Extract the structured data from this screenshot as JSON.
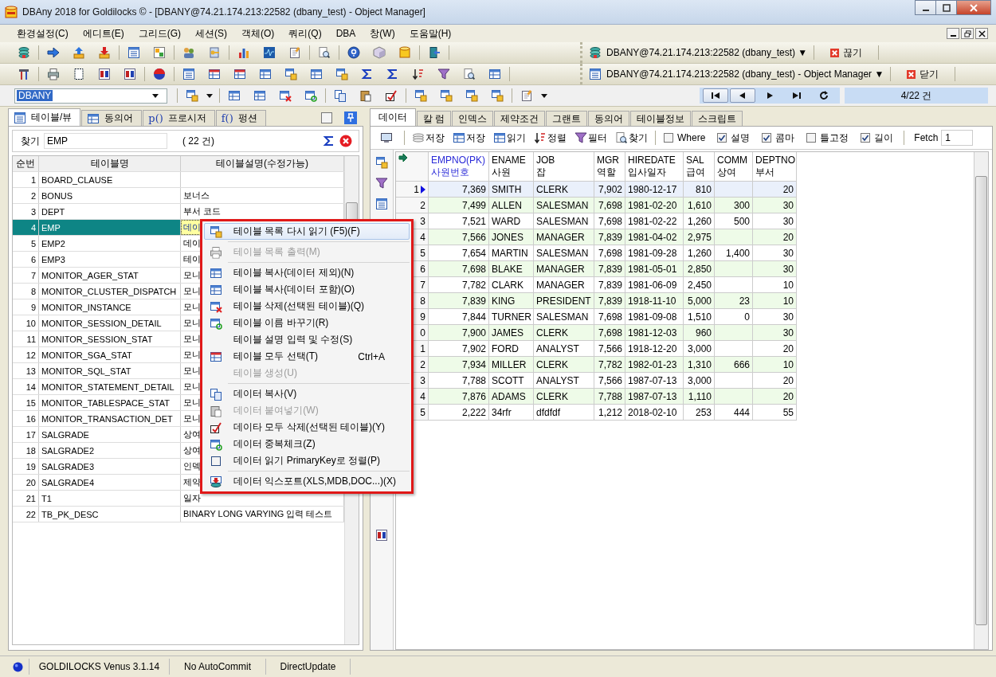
{
  "window": {
    "title": "DBAny 2018 for Goldilocks © - [DBANY@74.21.174.213:22582 (dbany_test) - Object Manager]"
  },
  "menu_bar": [
    "환경설정(C)",
    "에디트(E)",
    "그리드(G)",
    "세션(S)",
    "객체(O)",
    "쿼리(Q)",
    "DBA",
    "창(W)",
    "도움말(H)"
  ],
  "connection_bar": {
    "label": "DBANY@74.21.174.213:22582 (dbany_test) ▼",
    "action": "끊기"
  },
  "window_bar": {
    "label": "DBANY@74.21.174.213:22582 (dbany_test) - Object Manager ▼",
    "action": "닫기"
  },
  "schema_combo": {
    "value": "DBANY"
  },
  "record_counter": "4/22 건",
  "left_panel": {
    "tabs": [
      {
        "label": "테이블/뷰",
        "selected": true
      },
      {
        "label": "동의어",
        "selected": false
      },
      {
        "label": "프로시저",
        "icon_text": "p()",
        "selected": false
      },
      {
        "label": "펑션",
        "icon_text": "f()",
        "selected": false
      }
    ],
    "search": {
      "label": "찾기",
      "value": "EMP",
      "count": "( 22 건)"
    },
    "columns": [
      "순번",
      "테이블명",
      "테이블설명(수정가능)"
    ],
    "rows": [
      {
        "no": "1",
        "name": "BOARD_CLAUSE",
        "selected": false
      },
      {
        "no": "2",
        "name": "BONUS",
        "description": "보너스",
        "selected": false
      },
      {
        "no": "3",
        "name": "DEPT",
        "description": "부서 코드",
        "selected": false
      },
      {
        "no": "4",
        "name": "EMP",
        "description": "데이",
        "selected": true
      },
      {
        "no": "5",
        "name": "EMP2",
        "description": "데이",
        "selected": false
      },
      {
        "no": "6",
        "name": "EMP3",
        "description": "테이",
        "selected": false
      },
      {
        "no": "7",
        "name": "MONITOR_AGER_STAT",
        "description": "모니",
        "selected": false
      },
      {
        "no": "8",
        "name": "MONITOR_CLUSTER_DISPATCH",
        "description": "모니",
        "selected": false
      },
      {
        "no": "9",
        "name": "MONITOR_INSTANCE",
        "description": "모니",
        "selected": false
      },
      {
        "no": "10",
        "name": "MONITOR_SESSION_DETAIL",
        "description": "모니",
        "selected": false
      },
      {
        "no": "11",
        "name": "MONITOR_SESSION_STAT",
        "description": "모니",
        "selected": false
      },
      {
        "no": "12",
        "name": "MONITOR_SGA_STAT",
        "description": "모니",
        "selected": false
      },
      {
        "no": "13",
        "name": "MONITOR_SQL_STAT",
        "description": "모니",
        "selected": false
      },
      {
        "no": "14",
        "name": "MONITOR_STATEMENT_DETAIL",
        "description": "모니",
        "selected": false
      },
      {
        "no": "15",
        "name": "MONITOR_TABLESPACE_STAT",
        "description": "모니",
        "selected": false
      },
      {
        "no": "16",
        "name": "MONITOR_TRANSACTION_DET",
        "description": "모니",
        "selected": false
      },
      {
        "no": "17",
        "name": "SALGRADE",
        "description": "상여",
        "selected": false
      },
      {
        "no": "18",
        "name": "SALGRADE2",
        "description": "상여",
        "selected": false
      },
      {
        "no": "19",
        "name": "SALGRADE3",
        "description": "인덱",
        "selected": false
      },
      {
        "no": "20",
        "name": "SALGRADE4",
        "description": "제약",
        "selected": false
      },
      {
        "no": "21",
        "name": "T1",
        "description": "일자",
        "selected": false
      },
      {
        "no": "22",
        "name": "TB_PK_DESC",
        "description": "BINARY LONG VARYING 입력 테스트",
        "selected": false
      }
    ]
  },
  "context_menu": [
    {
      "kind": "item",
      "label": "테이블 목록 다시 읽기 (F5)(F)",
      "disabled": false,
      "highlighted": true
    },
    {
      "kind": "separator"
    },
    {
      "kind": "item",
      "label": "테이블 목록 출력(M)",
      "disabled": true,
      "highlighted": false
    },
    {
      "kind": "separator"
    },
    {
      "kind": "item",
      "label": "테이블 복사(데이터 제외)(N)",
      "disabled": false,
      "highlighted": false
    },
    {
      "kind": "item",
      "label": "테이블 복사(데이터 포함)(O)",
      "disabled": false,
      "highlighted": false
    },
    {
      "kind": "item",
      "label": "테이블 삭제(선택된 테이블)(Q)",
      "disabled": false,
      "highlighted": false
    },
    {
      "kind": "item",
      "label": "테이블 이름 바꾸기(R)",
      "disabled": false,
      "highlighted": false
    },
    {
      "kind": "item",
      "label": "테이블 설명 입력 및 수정(S)",
      "disabled": false,
      "highlighted": false
    },
    {
      "kind": "item",
      "label": "테이블 모두 선택(T)",
      "shortcut": "Ctrl+A",
      "disabled": false,
      "highlighted": false
    },
    {
      "kind": "item",
      "label": "테이블 생성(U)",
      "disabled": true,
      "highlighted": false
    },
    {
      "kind": "separator"
    },
    {
      "kind": "item",
      "label": "데이터 복사(V)",
      "disabled": false,
      "highlighted": false
    },
    {
      "kind": "item",
      "label": "데이터 붙여넣기(W)",
      "disabled": true,
      "highlighted": false
    },
    {
      "kind": "item",
      "label": "데이타 모두 삭제(선택된 테이블)(Y)",
      "disabled": false,
      "highlighted": false
    },
    {
      "kind": "item",
      "label": "데이터 중복체크(Z)",
      "disabled": false,
      "highlighted": false
    },
    {
      "kind": "item",
      "label": "데이터 읽기 PrimaryKey로 정렬(P)",
      "disabled": false,
      "highlighted": false
    },
    {
      "kind": "separator"
    },
    {
      "kind": "item",
      "label": "데이터 익스포트(XLS,MDB,DOC...)(X)",
      "disabled": false,
      "highlighted": false
    }
  ],
  "right_panel": {
    "tabs": [
      {
        "label": "데이터",
        "selected": true
      },
      {
        "label": "칼 럼",
        "selected": false
      },
      {
        "label": "인덱스",
        "selected": false
      },
      {
        "label": "제약조건",
        "selected": false
      },
      {
        "label": "그랜트",
        "selected": false
      },
      {
        "label": "동의어",
        "selected": false
      },
      {
        "label": "테이블정보",
        "selected": false
      },
      {
        "label": "스크립트",
        "selected": false
      }
    ],
    "toolbar_buttons": [
      "저장",
      "저장",
      "읽기",
      "정렬",
      "필터",
      "찾기"
    ],
    "options": [
      {
        "label": "Where",
        "checked": false
      },
      {
        "label": "설명",
        "checked": true
      },
      {
        "label": "콤마",
        "checked": true
      },
      {
        "label": "틀고정",
        "checked": false
      },
      {
        "label": "길이",
        "checked": true
      }
    ],
    "fetch": {
      "label": "Fetch",
      "value": "1"
    },
    "columns": [
      {
        "name": "EMPNO(PK)",
        "comment": "사원번호",
        "primary_key": true
      },
      {
        "name": "ENAME",
        "comment": "사원",
        "primary_key": false
      },
      {
        "name": "JOB",
        "comment": "잡",
        "primary_key": false
      },
      {
        "name": "MGR",
        "comment": "역할",
        "primary_key": false
      },
      {
        "name": "HIREDATE",
        "comment": "입사일자",
        "primary_key": false
      },
      {
        "name": "SAL",
        "comment": "급여",
        "primary_key": false
      },
      {
        "name": "COMM",
        "comment": "상여",
        "primary_key": false
      },
      {
        "name": "DEPTNO",
        "comment": "부서",
        "primary_key": false
      }
    ],
    "rows": [
      {
        "row_no": "1",
        "current": true,
        "cells": [
          "7,369",
          "SMITH",
          "CLERK",
          "7,902",
          "1980-12-17",
          "810",
          "",
          "20"
        ]
      },
      {
        "row_no": "2",
        "current": false,
        "cells": [
          "7,499",
          "ALLEN",
          "SALESMAN",
          "7,698",
          "1981-02-20",
          "1,610",
          "300",
          "30"
        ]
      },
      {
        "row_no": "3",
        "current": false,
        "cells": [
          "7,521",
          "WARD",
          "SALESMAN",
          "7,698",
          "1981-02-22",
          "1,260",
          "500",
          "30"
        ]
      },
      {
        "row_no": "4",
        "current": false,
        "cells": [
          "7,566",
          "JONES",
          "MANAGER",
          "7,839",
          "1981-04-02",
          "2,975",
          "",
          "20"
        ]
      },
      {
        "row_no": "5",
        "current": false,
        "cells": [
          "7,654",
          "MARTIN",
          "SALESMAN",
          "7,698",
          "1981-09-28",
          "1,260",
          "1,400",
          "30"
        ]
      },
      {
        "row_no": "6",
        "current": false,
        "cells": [
          "7,698",
          "BLAKE",
          "MANAGER",
          "7,839",
          "1981-05-01",
          "2,850",
          "",
          "30"
        ]
      },
      {
        "row_no": "7",
        "current": false,
        "cells": [
          "7,782",
          "CLARK",
          "MANAGER",
          "7,839",
          "1981-06-09",
          "2,450",
          "",
          "10"
        ]
      },
      {
        "row_no": "8",
        "current": false,
        "cells": [
          "7,839",
          "KING",
          "PRESIDENT",
          "7,839",
          "1918-11-10",
          "5,000",
          "23",
          "10"
        ]
      },
      {
        "row_no": "9",
        "current": false,
        "cells": [
          "7,844",
          "TURNER",
          "SALESMAN",
          "7,698",
          "1981-09-08",
          "1,510",
          "0",
          "30"
        ]
      },
      {
        "row_no": "0",
        "current": false,
        "cells": [
          "7,900",
          "JAMES",
          "CLERK",
          "7,698",
          "1981-12-03",
          "960",
          "",
          "30"
        ]
      },
      {
        "row_no": "1",
        "current": false,
        "cells": [
          "7,902",
          "FORD",
          "ANALYST",
          "7,566",
          "1918-12-20",
          "3,000",
          "",
          "20"
        ]
      },
      {
        "row_no": "2",
        "current": false,
        "cells": [
          "7,934",
          "MILLER",
          "CLERK",
          "7,782",
          "1982-01-23",
          "1,310",
          "666",
          "10"
        ]
      },
      {
        "row_no": "3",
        "current": false,
        "cells": [
          "7,788",
          "SCOTT",
          "ANALYST",
          "7,566",
          "1987-07-13",
          "3,000",
          "",
          "20"
        ]
      },
      {
        "row_no": "4",
        "current": false,
        "cells": [
          "7,876",
          "ADAMS",
          "CLERK",
          "7,788",
          "1987-07-13",
          "1,110",
          "",
          "20"
        ]
      },
      {
        "row_no": "5",
        "current": false,
        "cells": [
          "2,222",
          "34rfr",
          "dfdfdf",
          "1,212",
          "2018-02-10",
          "253",
          "444",
          "55"
        ]
      }
    ]
  },
  "status_bar": [
    "GOLDILOCKS Venus 3.1.14",
    "No AutoCommit",
    "DirectUpdate"
  ]
}
